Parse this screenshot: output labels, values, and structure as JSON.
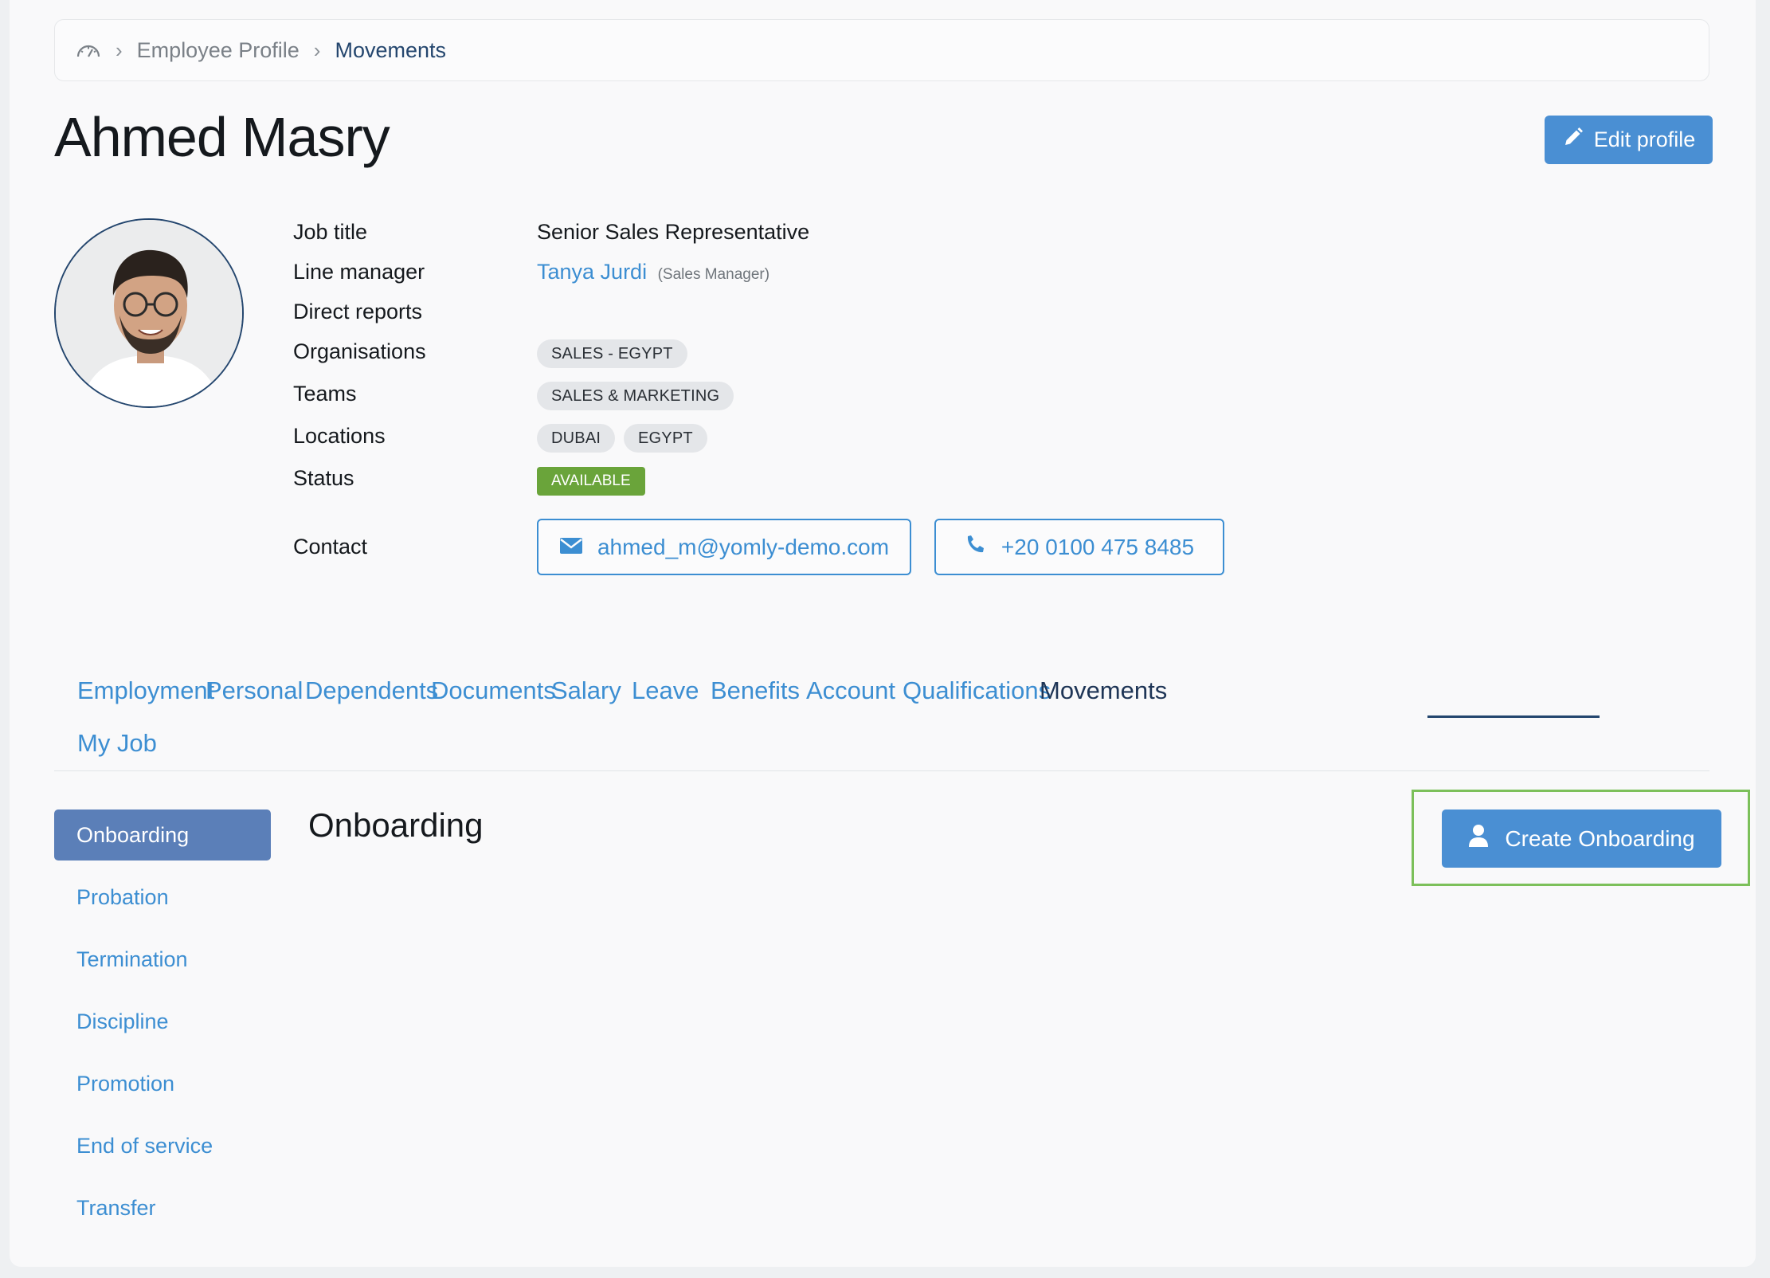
{
  "breadcrumb": {
    "home_icon": "dashboard-gauge-icon",
    "items": [
      "Employee Profile",
      "Movements"
    ]
  },
  "employee": {
    "name": "Ahmed Masry",
    "edit_label": "Edit profile"
  },
  "details": {
    "job_title_label": "Job title",
    "job_title": "Senior Sales Representative",
    "line_manager_label": "Line manager",
    "line_manager_name": "Tanya Jurdi",
    "line_manager_role": "(Sales Manager)",
    "direct_reports_label": "Direct reports",
    "organisations_label": "Organisations",
    "organisations": [
      "SALES - EGYPT"
    ],
    "teams_label": "Teams",
    "teams": [
      "SALES & MARKETING"
    ],
    "locations_label": "Locations",
    "locations": [
      "DUBAI",
      "EGYPT"
    ],
    "status_label": "Status",
    "status": "AVAILABLE",
    "contact_label": "Contact",
    "email": "ahmed_m@yomly-demo.com",
    "phone": "+20 0100 475 8485"
  },
  "tabs": [
    "Employment",
    "Personal",
    "Dependents",
    "Documents",
    "Salary",
    "Leave",
    "Benefits",
    "Account",
    "Qualifications",
    "Movements",
    "My Job"
  ],
  "active_tab": "Movements",
  "movements_nav": {
    "active": "Onboarding",
    "items": [
      "Probation",
      "Termination",
      "Discipline",
      "Promotion",
      "End of service",
      "Transfer"
    ]
  },
  "section": {
    "title": "Onboarding",
    "create_label": "Create Onboarding"
  },
  "colors": {
    "accent": "#4a8fd3",
    "link": "#3c8ed2",
    "status_available": "#6aa43a",
    "highlight": "#7cc05a"
  }
}
